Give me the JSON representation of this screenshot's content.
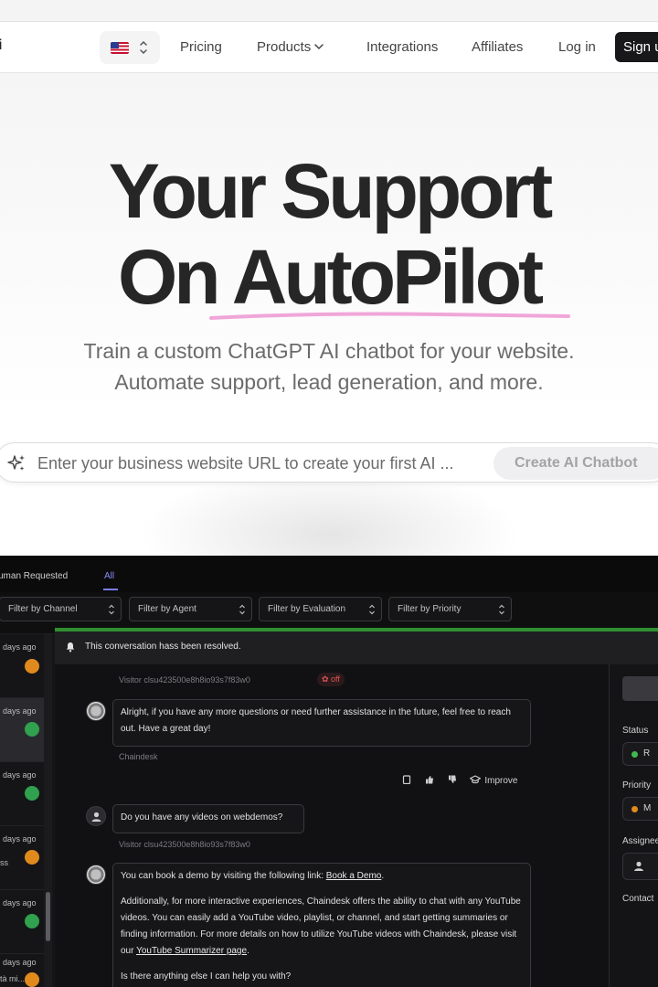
{
  "nav": {
    "logo_fragment": "i",
    "language_flag": "us-flag",
    "links": [
      "Pricing",
      "Products",
      "Integrations",
      "Affiliates",
      "Log in"
    ],
    "signup": "Sign up"
  },
  "hero": {
    "title_line1": "Your Support",
    "title_line2": "On AutoPilot",
    "subtitle_line1": "Train a custom ChatGPT AI chatbot for your website.",
    "subtitle_line2": "Automate support, lead generation, and more.",
    "url_placeholder": "Enter your business website URL to create your first AI ...",
    "cta": "Create AI Chatbot",
    "underline_color": "#f0a6d8"
  },
  "app": {
    "tabs": [
      "uman Requested",
      "All"
    ],
    "active_tab": "All",
    "filters": [
      "Filter by Channel",
      "Filter by Agent",
      "Filter by Evaluation",
      "Filter by Priority"
    ],
    "banner": "This conversation hass been resolved.",
    "conversations": [
      {
        "time": "days ago",
        "status": "user"
      },
      {
        "time": "days ago",
        "status": "ok"
      },
      {
        "time": "days ago",
        "status": "ok"
      },
      {
        "time": "days ago",
        "extra": "ss",
        "status": "user"
      },
      {
        "time": "days ago",
        "status": "ok"
      },
      {
        "time": "days ago",
        "extra": "tà mi...",
        "status": "user"
      }
    ],
    "messages": {
      "visitor_meta_1": "Visitor clsu423500e8h8io93s7f83w0",
      "off_badge": "off",
      "bot_msg_1": "Alright, if you have any more questions or need further assistance in the future, feel free to reach out. Have a great day!",
      "bot_meta": "Chaindesk",
      "improve": "Improve",
      "user_msg": "Do you have any videos on webdemos?",
      "visitor_meta_2": "Visitor clsu423500e8h8io93s7f83w0",
      "bot_msg_2_a": "You can book a demo by visiting the following link: ",
      "bot_msg_2_link": "Book a Demo",
      "bot_msg_2_b": "Additionally, for more interactive experiences, Chaindesk offers the ability to chat with any YouTube videos. You can easily add a YouTube video, playlist, or channel, and start getting summaries or finding information. For more details on how to utilize YouTube videos with Chaindesk, please visit our ",
      "bot_msg_2_link2": "YouTube Summarizer page",
      "bot_msg_2_c": "Is there anything else I can help you with?"
    },
    "side": {
      "status_label": "Status",
      "status_value": "R",
      "priority_label": "Priority",
      "priority_value": "M",
      "assignee_label": "Assignee",
      "contact_label": "Contact",
      "status_color": "#3fb950",
      "priority_color": "#e08a1e"
    }
  }
}
